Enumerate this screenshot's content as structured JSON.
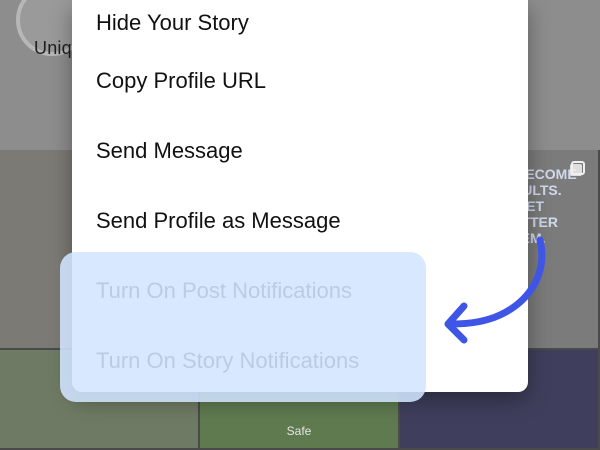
{
  "background": {
    "story_label": "Uniq",
    "sign_lines": [
      "S BECOME",
      "ADULTS.",
      "S GET",
      "BETTER",
      "THEM."
    ],
    "tile_caption": "Safe"
  },
  "menu": {
    "items": [
      {
        "label": "Hide Your Story"
      },
      {
        "label": "Copy Profile URL"
      },
      {
        "label": "Send Message"
      },
      {
        "label": "Send Profile as Message"
      },
      {
        "label": "Turn On Post Notifications"
      },
      {
        "label": "Turn On Story Notifications"
      }
    ]
  },
  "colors": {
    "menu_bg": "#ffffff",
    "highlight": "#d2e5ff",
    "arrow": "#3f55e6"
  },
  "icons": {
    "arrow": "curved-arrow-icon",
    "multi": "multi-post-icon"
  }
}
